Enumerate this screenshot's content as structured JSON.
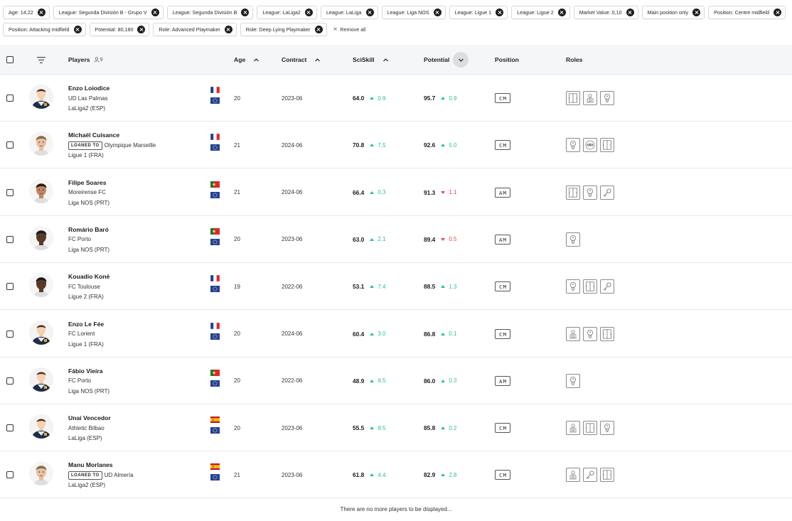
{
  "filters": [
    {
      "label": "Age: 14,22"
    },
    {
      "label": "League: Segunda División B - Grupo V"
    },
    {
      "label": "League: Segunda División B"
    },
    {
      "label": "League: LaLiga2"
    },
    {
      "label": "League: LaLiga"
    },
    {
      "label": "League: Liga NOS"
    },
    {
      "label": "League: Ligue 1"
    },
    {
      "label": "League: Ligue 2"
    },
    {
      "label": "Market Value: 0,10"
    },
    {
      "label": "Main position only"
    },
    {
      "label": "Position: Centre midfield"
    },
    {
      "label": "Position: Attacking midfield"
    },
    {
      "label": "Potential: 80,180"
    },
    {
      "label": "Role: Advanced Playmaker"
    },
    {
      "label": "Role: Deep Lying Playmaker"
    }
  ],
  "remove_all_label": "Remove all",
  "columns": {
    "players": "Players",
    "players_count": "9",
    "age": "Age",
    "contract": "Contract",
    "sciskill": "SciSkill",
    "potential": "Potential",
    "position": "Position",
    "roles": "Roles"
  },
  "colors": {
    "up": "#2ec27e",
    "down": "#e5484d",
    "header_bg": "#f5f6f7"
  },
  "loan_label": "LOANED TO",
  "players": [
    {
      "name": "Enzo Loiodice",
      "team": "UD Las Palmas",
      "loaned": false,
      "league": "LaLiga2 (ESP)",
      "nation": "fr",
      "age": "20",
      "contract": "2023-06",
      "sciskill": "64.0",
      "sci_delta": "0.9",
      "sci_dir": "up",
      "potential": "95.7",
      "pot_delta": "0.9",
      "pot_dir": "up",
      "position": "CM",
      "avatar": "silhouette",
      "roles": [
        "pitch-line-icon",
        "lock-figure-icon",
        "bulb-figure-icon"
      ]
    },
    {
      "name": "Michaël Cuisance",
      "team": "Olympique Marseille",
      "loaned": true,
      "league": "Ligue 1 (FRA)",
      "nation": "fr",
      "age": "21",
      "contract": "2024-06",
      "sciskill": "70.8",
      "sci_delta": "7.5",
      "sci_dir": "up",
      "potential": "92.6",
      "pot_delta": "5.0",
      "pot_dir": "up",
      "position": "CM",
      "avatar": "photo-light",
      "roles": [
        "bulb-figure-icon",
        "mask-icon",
        "pitch-line-icon"
      ]
    },
    {
      "name": "Filipe Soares",
      "team": "Moreirense FC",
      "loaned": false,
      "league": "Liga NOS (PRT)",
      "nation": "pt",
      "age": "21",
      "contract": "2024-06",
      "sciskill": "66.4",
      "sci_delta": "0.3",
      "sci_dir": "up",
      "potential": "91.3",
      "pot_delta": "1.1",
      "pot_dir": "down",
      "position": "AM",
      "avatar": "photo-mid",
      "roles": [
        "pitch-line-icon",
        "bulb-figure-icon",
        "key-icon"
      ]
    },
    {
      "name": "Romário Baró",
      "team": "FC Porto",
      "loaned": false,
      "league": "Liga NOS (PRT)",
      "nation": "pt",
      "age": "20",
      "contract": "2023-06",
      "sciskill": "63.0",
      "sci_delta": "2.1",
      "sci_dir": "up",
      "potential": "89.4",
      "pot_delta": "0.5",
      "pot_dir": "down",
      "position": "AM",
      "avatar": "photo-dark",
      "roles": [
        "bulb-figure-icon"
      ]
    },
    {
      "name": "Kouadio Koné",
      "team": "FC Toulouse",
      "loaned": false,
      "league": "Ligue 2 (FRA)",
      "nation": "fr",
      "age": "19",
      "contract": "2022-06",
      "sciskill": "53.1",
      "sci_delta": "7.4",
      "sci_dir": "up",
      "potential": "88.5",
      "pot_delta": "1.3",
      "pot_dir": "up",
      "position": "CM",
      "avatar": "photo-dark",
      "roles": [
        "bulb-figure-icon",
        "pitch-line-icon",
        "key-icon"
      ]
    },
    {
      "name": "Enzo Le Fée",
      "team": "FC Lorient",
      "loaned": false,
      "league": "Ligue 1 (FRA)",
      "nation": "fr",
      "age": "20",
      "contract": "2024-06",
      "sciskill": "60.4",
      "sci_delta": "3.0",
      "sci_dir": "up",
      "potential": "86.8",
      "pot_delta": "0.1",
      "pot_dir": "up",
      "position": "CM",
      "avatar": "silhouette",
      "roles": [
        "lock-figure-icon",
        "bulb-figure-icon",
        "pitch-line-icon"
      ]
    },
    {
      "name": "Fábio Vieira",
      "team": "FC Porto",
      "loaned": false,
      "league": "Liga NOS (PRT)",
      "nation": "pt",
      "age": "20",
      "contract": "2022-06",
      "sciskill": "48.9",
      "sci_delta": "6.5",
      "sci_dir": "up",
      "potential": "86.0",
      "pot_delta": "0.3",
      "pot_dir": "up",
      "position": "AM",
      "avatar": "silhouette",
      "roles": [
        "bulb-figure-icon"
      ]
    },
    {
      "name": "Unai Vencedor",
      "team": "Athletic Bilbao",
      "loaned": false,
      "league": "LaLiga (ESP)",
      "nation": "es",
      "age": "20",
      "contract": "2023-06",
      "sciskill": "55.5",
      "sci_delta": "8.5",
      "sci_dir": "up",
      "potential": "85.8",
      "pot_delta": "0.2",
      "pot_dir": "up",
      "position": "CM",
      "avatar": "silhouette",
      "roles": [
        "lock-figure-icon",
        "pitch-line-icon",
        "bulb-figure-icon"
      ]
    },
    {
      "name": "Manu Morlanes",
      "team": "UD Almería",
      "loaned": true,
      "league": "LaLiga2 (ESP)",
      "nation": "es",
      "age": "21",
      "contract": "2023-06",
      "sciskill": "61.8",
      "sci_delta": "4.4",
      "sci_dir": "up",
      "potential": "82.9",
      "pot_delta": "2.8",
      "pot_dir": "up",
      "position": "CM",
      "avatar": "photo-light",
      "roles": [
        "lock-figure-icon",
        "key-icon",
        "pitch-line-icon"
      ]
    }
  ],
  "footer_text": "There are no more players to be displayed..."
}
